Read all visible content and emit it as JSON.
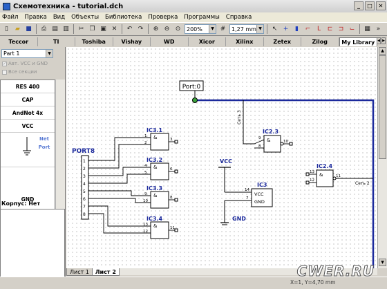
{
  "window": {
    "title": "Схемотехника - tutorial.dch"
  },
  "menu": [
    "Файл",
    "Правка",
    "Вид",
    "Объекты",
    "Библиотека",
    "Проверка",
    "Программы",
    "Справка"
  ],
  "toolbar": {
    "zoom": "200%",
    "grid": "1,27 mm"
  },
  "library_tabs": [
    "Teccor",
    "TI",
    "Toshiba",
    "Vishay",
    "WD",
    "Xicor",
    "Xilinx",
    "Zetex",
    "Zilog",
    "My Library"
  ],
  "left": {
    "part_select": "Part 1",
    "auto_vcc": "Авт. VCC и GND",
    "all_sections": "Все секции",
    "components": [
      "RES 400",
      "CAP",
      "AndNot 4x",
      "VCC"
    ],
    "net_port": "Net Port",
    "gnd": "GND",
    "korpus": "Корпус: Нет"
  },
  "schematic": {
    "port_label": "Port:0",
    "port8": "PORT8",
    "gates": [
      "IC3.1",
      "IC3.2",
      "IC3.3",
      "IC3.4",
      "IC2.3",
      "IC2.4"
    ],
    "ic3": "IC3",
    "vcc": "VCC",
    "gnd": "GND",
    "pin_vcc": "VCC",
    "pin_gnd": "GND",
    "net3": "Сеть 3",
    "net2": "Сеть 2",
    "and": "&"
  },
  "sheets": [
    "Лист 1",
    "Лист 2"
  ],
  "status": {
    "coords": "X=1, Y=4,70 mm"
  },
  "watermark": "CWER.RU"
}
